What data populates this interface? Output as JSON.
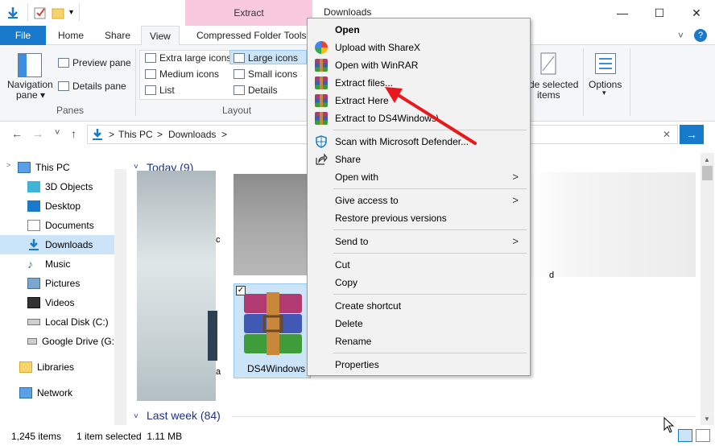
{
  "window": {
    "context_tab": "Extract",
    "title": "Downloads",
    "minimize": "—",
    "maximize": "☐",
    "close": "✕"
  },
  "ribbon_tabs": {
    "file": "File",
    "home": "Home",
    "share": "Share",
    "view": "View",
    "compressed": "Compressed Folder Tools",
    "chevron": "˅",
    "help": "?"
  },
  "ribbon": {
    "navigation_pane": "Navigation",
    "navigation_pane_2": "pane ▾",
    "preview_pane": "Preview pane",
    "details_pane": "Details pane",
    "panes_group": "Panes",
    "extra_large_icons": "Extra large icons",
    "large_icons": "Large icons",
    "medium_icons": "Medium icons",
    "small_icons": "Small icons",
    "list": "List",
    "details": "Details",
    "layout_group": "Layout",
    "hide_selected": "de selected",
    "hide_selected_2": "items",
    "options": "Options",
    "options_arrow": "▾"
  },
  "address": {
    "back": "←",
    "forward": "→",
    "recent": "˅",
    "up": "↑",
    "crumbs": [
      "This PC",
      ">",
      "Downloads",
      ">"
    ],
    "clear": "✕",
    "go": "→"
  },
  "nav": {
    "items": [
      "This PC",
      "3D Objects",
      "Desktop",
      "Documents",
      "Downloads",
      "Music",
      "Pictures",
      "Videos",
      "Local Disk (C:)",
      "Google Drive (G:",
      "Libraries",
      "Network"
    ],
    "expand": ">"
  },
  "content": {
    "group_today": "Today (9)",
    "group_last_week": "Last week (84)",
    "collapse": "˅",
    "selected_file": "DS4Windows",
    "partial_c": "c",
    "partial_a": "a",
    "partial_d": "d"
  },
  "status": {
    "count": "1,245 items",
    "selection": "1 item selected  1.11 MB"
  },
  "context_menu": {
    "open": "Open",
    "upload_sharex": "Upload with ShareX",
    "open_winrar": "Open with WinRAR",
    "extract_files": "Extract files...",
    "extract_here": "Extract Here",
    "extract_to": "Extract to DS4Windows\\",
    "scan_defender": "Scan with Microsoft Defender...",
    "share": "Share",
    "open_with": "Open with",
    "give_access": "Give access to",
    "restore_versions": "Restore previous versions",
    "send_to": "Send to",
    "cut": "Cut",
    "copy": "Copy",
    "create_shortcut": "Create shortcut",
    "delete": "Delete",
    "rename": "Rename",
    "properties": "Properties",
    "submenu_arrow": ">"
  },
  "colors": {
    "accent": "#1979ca",
    "context_tab": "#f9c9e0",
    "annotation_arrow": "#e8191c"
  }
}
